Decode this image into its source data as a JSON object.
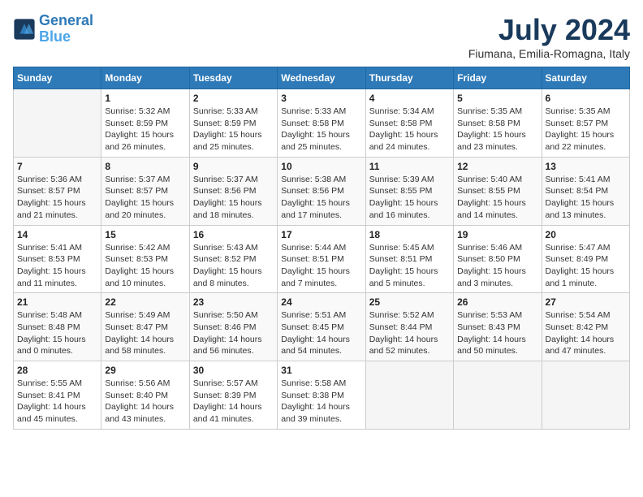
{
  "header": {
    "logo_line1": "General",
    "logo_line2": "Blue",
    "title": "July 2024",
    "subtitle": "Fiumana, Emilia-Romagna, Italy"
  },
  "weekdays": [
    "Sunday",
    "Monday",
    "Tuesday",
    "Wednesday",
    "Thursday",
    "Friday",
    "Saturday"
  ],
  "weeks": [
    [
      {
        "day": "",
        "info": ""
      },
      {
        "day": "1",
        "info": "Sunrise: 5:32 AM\nSunset: 8:59 PM\nDaylight: 15 hours\nand 26 minutes."
      },
      {
        "day": "2",
        "info": "Sunrise: 5:33 AM\nSunset: 8:59 PM\nDaylight: 15 hours\nand 25 minutes."
      },
      {
        "day": "3",
        "info": "Sunrise: 5:33 AM\nSunset: 8:58 PM\nDaylight: 15 hours\nand 25 minutes."
      },
      {
        "day": "4",
        "info": "Sunrise: 5:34 AM\nSunset: 8:58 PM\nDaylight: 15 hours\nand 24 minutes."
      },
      {
        "day": "5",
        "info": "Sunrise: 5:35 AM\nSunset: 8:58 PM\nDaylight: 15 hours\nand 23 minutes."
      },
      {
        "day": "6",
        "info": "Sunrise: 5:35 AM\nSunset: 8:57 PM\nDaylight: 15 hours\nand 22 minutes."
      }
    ],
    [
      {
        "day": "7",
        "info": "Sunrise: 5:36 AM\nSunset: 8:57 PM\nDaylight: 15 hours\nand 21 minutes."
      },
      {
        "day": "8",
        "info": "Sunrise: 5:37 AM\nSunset: 8:57 PM\nDaylight: 15 hours\nand 20 minutes."
      },
      {
        "day": "9",
        "info": "Sunrise: 5:37 AM\nSunset: 8:56 PM\nDaylight: 15 hours\nand 18 minutes."
      },
      {
        "day": "10",
        "info": "Sunrise: 5:38 AM\nSunset: 8:56 PM\nDaylight: 15 hours\nand 17 minutes."
      },
      {
        "day": "11",
        "info": "Sunrise: 5:39 AM\nSunset: 8:55 PM\nDaylight: 15 hours\nand 16 minutes."
      },
      {
        "day": "12",
        "info": "Sunrise: 5:40 AM\nSunset: 8:55 PM\nDaylight: 15 hours\nand 14 minutes."
      },
      {
        "day": "13",
        "info": "Sunrise: 5:41 AM\nSunset: 8:54 PM\nDaylight: 15 hours\nand 13 minutes."
      }
    ],
    [
      {
        "day": "14",
        "info": "Sunrise: 5:41 AM\nSunset: 8:53 PM\nDaylight: 15 hours\nand 11 minutes."
      },
      {
        "day": "15",
        "info": "Sunrise: 5:42 AM\nSunset: 8:53 PM\nDaylight: 15 hours\nand 10 minutes."
      },
      {
        "day": "16",
        "info": "Sunrise: 5:43 AM\nSunset: 8:52 PM\nDaylight: 15 hours\nand 8 minutes."
      },
      {
        "day": "17",
        "info": "Sunrise: 5:44 AM\nSunset: 8:51 PM\nDaylight: 15 hours\nand 7 minutes."
      },
      {
        "day": "18",
        "info": "Sunrise: 5:45 AM\nSunset: 8:51 PM\nDaylight: 15 hours\nand 5 minutes."
      },
      {
        "day": "19",
        "info": "Sunrise: 5:46 AM\nSunset: 8:50 PM\nDaylight: 15 hours\nand 3 minutes."
      },
      {
        "day": "20",
        "info": "Sunrise: 5:47 AM\nSunset: 8:49 PM\nDaylight: 15 hours\nand 1 minute."
      }
    ],
    [
      {
        "day": "21",
        "info": "Sunrise: 5:48 AM\nSunset: 8:48 PM\nDaylight: 15 hours\nand 0 minutes."
      },
      {
        "day": "22",
        "info": "Sunrise: 5:49 AM\nSunset: 8:47 PM\nDaylight: 14 hours\nand 58 minutes."
      },
      {
        "day": "23",
        "info": "Sunrise: 5:50 AM\nSunset: 8:46 PM\nDaylight: 14 hours\nand 56 minutes."
      },
      {
        "day": "24",
        "info": "Sunrise: 5:51 AM\nSunset: 8:45 PM\nDaylight: 14 hours\nand 54 minutes."
      },
      {
        "day": "25",
        "info": "Sunrise: 5:52 AM\nSunset: 8:44 PM\nDaylight: 14 hours\nand 52 minutes."
      },
      {
        "day": "26",
        "info": "Sunrise: 5:53 AM\nSunset: 8:43 PM\nDaylight: 14 hours\nand 50 minutes."
      },
      {
        "day": "27",
        "info": "Sunrise: 5:54 AM\nSunset: 8:42 PM\nDaylight: 14 hours\nand 47 minutes."
      }
    ],
    [
      {
        "day": "28",
        "info": "Sunrise: 5:55 AM\nSunset: 8:41 PM\nDaylight: 14 hours\nand 45 minutes."
      },
      {
        "day": "29",
        "info": "Sunrise: 5:56 AM\nSunset: 8:40 PM\nDaylight: 14 hours\nand 43 minutes."
      },
      {
        "day": "30",
        "info": "Sunrise: 5:57 AM\nSunset: 8:39 PM\nDaylight: 14 hours\nand 41 minutes."
      },
      {
        "day": "31",
        "info": "Sunrise: 5:58 AM\nSunset: 8:38 PM\nDaylight: 14 hours\nand 39 minutes."
      },
      {
        "day": "",
        "info": ""
      },
      {
        "day": "",
        "info": ""
      },
      {
        "day": "",
        "info": ""
      }
    ]
  ]
}
